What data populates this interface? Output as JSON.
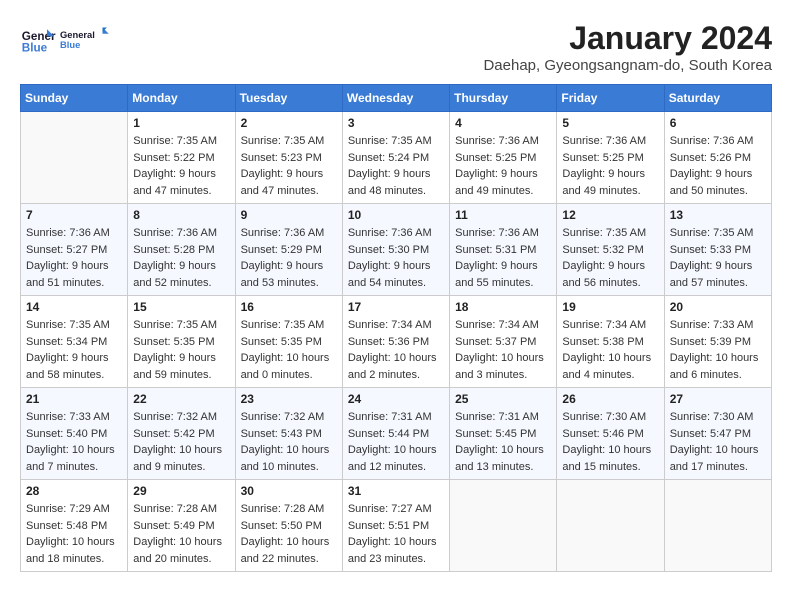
{
  "header": {
    "logo_line1": "General",
    "logo_line2": "Blue",
    "month_title": "January 2024",
    "subtitle": "Daehap, Gyeongsangnam-do, South Korea"
  },
  "days_of_week": [
    "Sunday",
    "Monday",
    "Tuesday",
    "Wednesday",
    "Thursday",
    "Friday",
    "Saturday"
  ],
  "weeks": [
    [
      {
        "day": "",
        "sunrise": "",
        "sunset": "",
        "daylight": ""
      },
      {
        "day": "1",
        "sunrise": "Sunrise: 7:35 AM",
        "sunset": "Sunset: 5:22 PM",
        "daylight": "Daylight: 9 hours and 47 minutes."
      },
      {
        "day": "2",
        "sunrise": "Sunrise: 7:35 AM",
        "sunset": "Sunset: 5:23 PM",
        "daylight": "Daylight: 9 hours and 47 minutes."
      },
      {
        "day": "3",
        "sunrise": "Sunrise: 7:35 AM",
        "sunset": "Sunset: 5:24 PM",
        "daylight": "Daylight: 9 hours and 48 minutes."
      },
      {
        "day": "4",
        "sunrise": "Sunrise: 7:36 AM",
        "sunset": "Sunset: 5:25 PM",
        "daylight": "Daylight: 9 hours and 49 minutes."
      },
      {
        "day": "5",
        "sunrise": "Sunrise: 7:36 AM",
        "sunset": "Sunset: 5:25 PM",
        "daylight": "Daylight: 9 hours and 49 minutes."
      },
      {
        "day": "6",
        "sunrise": "Sunrise: 7:36 AM",
        "sunset": "Sunset: 5:26 PM",
        "daylight": "Daylight: 9 hours and 50 minutes."
      }
    ],
    [
      {
        "day": "7",
        "sunrise": "Sunrise: 7:36 AM",
        "sunset": "Sunset: 5:27 PM",
        "daylight": "Daylight: 9 hours and 51 minutes."
      },
      {
        "day": "8",
        "sunrise": "Sunrise: 7:36 AM",
        "sunset": "Sunset: 5:28 PM",
        "daylight": "Daylight: 9 hours and 52 minutes."
      },
      {
        "day": "9",
        "sunrise": "Sunrise: 7:36 AM",
        "sunset": "Sunset: 5:29 PM",
        "daylight": "Daylight: 9 hours and 53 minutes."
      },
      {
        "day": "10",
        "sunrise": "Sunrise: 7:36 AM",
        "sunset": "Sunset: 5:30 PM",
        "daylight": "Daylight: 9 hours and 54 minutes."
      },
      {
        "day": "11",
        "sunrise": "Sunrise: 7:36 AM",
        "sunset": "Sunset: 5:31 PM",
        "daylight": "Daylight: 9 hours and 55 minutes."
      },
      {
        "day": "12",
        "sunrise": "Sunrise: 7:35 AM",
        "sunset": "Sunset: 5:32 PM",
        "daylight": "Daylight: 9 hours and 56 minutes."
      },
      {
        "day": "13",
        "sunrise": "Sunrise: 7:35 AM",
        "sunset": "Sunset: 5:33 PM",
        "daylight": "Daylight: 9 hours and 57 minutes."
      }
    ],
    [
      {
        "day": "14",
        "sunrise": "Sunrise: 7:35 AM",
        "sunset": "Sunset: 5:34 PM",
        "daylight": "Daylight: 9 hours and 58 minutes."
      },
      {
        "day": "15",
        "sunrise": "Sunrise: 7:35 AM",
        "sunset": "Sunset: 5:35 PM",
        "daylight": "Daylight: 9 hours and 59 minutes."
      },
      {
        "day": "16",
        "sunrise": "Sunrise: 7:35 AM",
        "sunset": "Sunset: 5:35 PM",
        "daylight": "Daylight: 10 hours and 0 minutes."
      },
      {
        "day": "17",
        "sunrise": "Sunrise: 7:34 AM",
        "sunset": "Sunset: 5:36 PM",
        "daylight": "Daylight: 10 hours and 2 minutes."
      },
      {
        "day": "18",
        "sunrise": "Sunrise: 7:34 AM",
        "sunset": "Sunset: 5:37 PM",
        "daylight": "Daylight: 10 hours and 3 minutes."
      },
      {
        "day": "19",
        "sunrise": "Sunrise: 7:34 AM",
        "sunset": "Sunset: 5:38 PM",
        "daylight": "Daylight: 10 hours and 4 minutes."
      },
      {
        "day": "20",
        "sunrise": "Sunrise: 7:33 AM",
        "sunset": "Sunset: 5:39 PM",
        "daylight": "Daylight: 10 hours and 6 minutes."
      }
    ],
    [
      {
        "day": "21",
        "sunrise": "Sunrise: 7:33 AM",
        "sunset": "Sunset: 5:40 PM",
        "daylight": "Daylight: 10 hours and 7 minutes."
      },
      {
        "day": "22",
        "sunrise": "Sunrise: 7:32 AM",
        "sunset": "Sunset: 5:42 PM",
        "daylight": "Daylight: 10 hours and 9 minutes."
      },
      {
        "day": "23",
        "sunrise": "Sunrise: 7:32 AM",
        "sunset": "Sunset: 5:43 PM",
        "daylight": "Daylight: 10 hours and 10 minutes."
      },
      {
        "day": "24",
        "sunrise": "Sunrise: 7:31 AM",
        "sunset": "Sunset: 5:44 PM",
        "daylight": "Daylight: 10 hours and 12 minutes."
      },
      {
        "day": "25",
        "sunrise": "Sunrise: 7:31 AM",
        "sunset": "Sunset: 5:45 PM",
        "daylight": "Daylight: 10 hours and 13 minutes."
      },
      {
        "day": "26",
        "sunrise": "Sunrise: 7:30 AM",
        "sunset": "Sunset: 5:46 PM",
        "daylight": "Daylight: 10 hours and 15 minutes."
      },
      {
        "day": "27",
        "sunrise": "Sunrise: 7:30 AM",
        "sunset": "Sunset: 5:47 PM",
        "daylight": "Daylight: 10 hours and 17 minutes."
      }
    ],
    [
      {
        "day": "28",
        "sunrise": "Sunrise: 7:29 AM",
        "sunset": "Sunset: 5:48 PM",
        "daylight": "Daylight: 10 hours and 18 minutes."
      },
      {
        "day": "29",
        "sunrise": "Sunrise: 7:28 AM",
        "sunset": "Sunset: 5:49 PM",
        "daylight": "Daylight: 10 hours and 20 minutes."
      },
      {
        "day": "30",
        "sunrise": "Sunrise: 7:28 AM",
        "sunset": "Sunset: 5:50 PM",
        "daylight": "Daylight: 10 hours and 22 minutes."
      },
      {
        "day": "31",
        "sunrise": "Sunrise: 7:27 AM",
        "sunset": "Sunset: 5:51 PM",
        "daylight": "Daylight: 10 hours and 23 minutes."
      },
      {
        "day": "",
        "sunrise": "",
        "sunset": "",
        "daylight": ""
      },
      {
        "day": "",
        "sunrise": "",
        "sunset": "",
        "daylight": ""
      },
      {
        "day": "",
        "sunrise": "",
        "sunset": "",
        "daylight": ""
      }
    ]
  ]
}
